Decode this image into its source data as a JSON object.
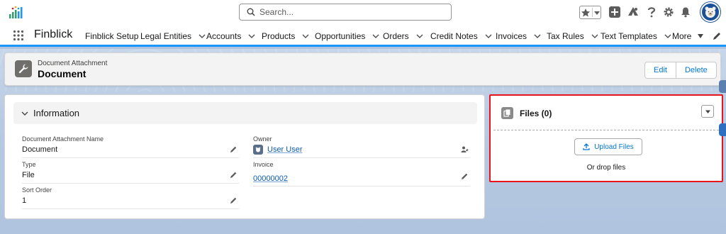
{
  "header": {
    "search_placeholder": "Search...",
    "icons": [
      "app-logo-icon",
      "search-icon",
      "favorites-star-icon",
      "favorites-dropdown-icon",
      "add-icon",
      "trailhead-icon",
      "help-icon",
      "setup-gear-icon",
      "notifications-bell-icon",
      "avatar"
    ]
  },
  "nav": {
    "app_name": "Finblick",
    "items": [
      {
        "label": "Finblick Setup",
        "has_menu": false
      },
      {
        "label": "Legal Entities",
        "has_menu": true
      },
      {
        "label": "Accounts",
        "has_menu": true
      },
      {
        "label": "Products",
        "has_menu": true
      },
      {
        "label": "Opportunities",
        "has_menu": true
      },
      {
        "label": "Orders",
        "has_menu": true
      },
      {
        "label": "Credit Notes",
        "has_menu": true
      },
      {
        "label": "Invoices",
        "has_menu": true
      },
      {
        "label": "Tax Rules",
        "has_menu": true
      },
      {
        "label": "Text Templates",
        "has_menu": true
      },
      {
        "label": "More",
        "has_menu": true
      }
    ]
  },
  "record": {
    "type_label": "Document Attachment",
    "title": "Document",
    "edit_label": "Edit",
    "delete_label": "Delete"
  },
  "information": {
    "section_title": "Information",
    "fields": {
      "name": {
        "label": "Document Attachment Name",
        "value": "Document"
      },
      "type": {
        "label": "Type",
        "value": "File"
      },
      "sort_order": {
        "label": "Sort Order",
        "value": "1"
      },
      "owner": {
        "label": "Owner",
        "value": "User User"
      },
      "invoice": {
        "label": "Invoice",
        "value": "00000002"
      }
    }
  },
  "files": {
    "title": "Files (0)",
    "upload_label": "Upload Files",
    "drop_text": "Or drop files"
  },
  "colors": {
    "brand_blue": "#0176d3",
    "highlight_red": "#e8141b",
    "page_background": "#b0c4df",
    "nav_underline": "#1b96ff"
  }
}
